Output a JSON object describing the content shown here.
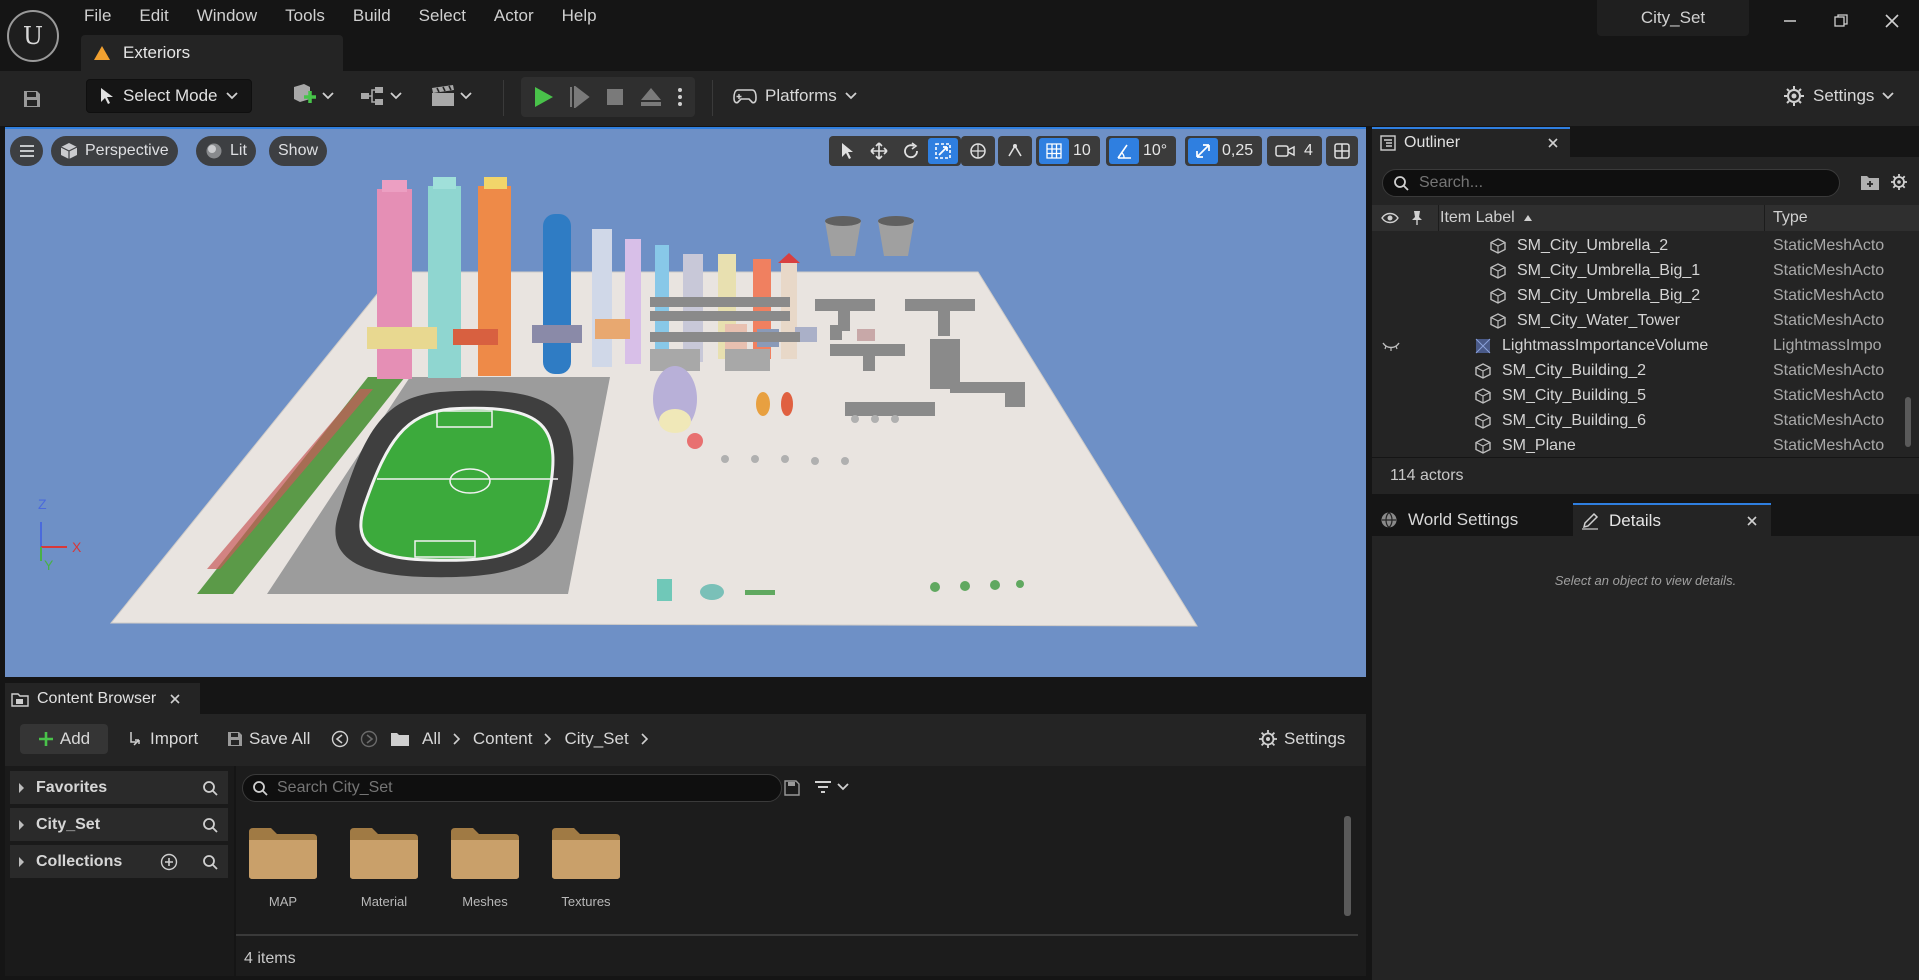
{
  "menu": [
    "File",
    "Edit",
    "Window",
    "Tools",
    "Build",
    "Select",
    "Actor",
    "Help"
  ],
  "level_tab": "Exteriors",
  "project_name": "City_Set",
  "toolbar": {
    "select_mode": "Select Mode",
    "platforms": "Platforms",
    "settings": "Settings"
  },
  "viewport": {
    "perspective": "Perspective",
    "lit": "Lit",
    "show": "Show",
    "grid_snap": "10",
    "rotation_snap": "10°",
    "scale_snap": "0,25",
    "camera_speed": "4",
    "axis": {
      "z": "Z",
      "x": "X",
      "y": "Y"
    },
    "colors": {
      "sky": "#6e90c6",
      "ground": "#e9e4e0",
      "field": "#3caa3c",
      "track": "#3f3f3f",
      "accent": "#2f7fe0"
    }
  },
  "outliner": {
    "title": "Outliner",
    "search_placeholder": "Search...",
    "col_label": "Item Label",
    "col_type": "Type",
    "rows": [
      {
        "label": "SM_City_Umbrella_2",
        "type": "StaticMeshActo",
        "indent": 2
      },
      {
        "label": "SM_City_Umbrella_Big_1",
        "type": "StaticMeshActo",
        "indent": 2
      },
      {
        "label": "SM_City_Umbrella_Big_2",
        "type": "StaticMeshActo",
        "indent": 2
      },
      {
        "label": "SM_City_Water_Tower",
        "type": "StaticMeshActo",
        "indent": 2
      },
      {
        "label": "LightmassImportanceVolume",
        "type": "LightmassImpo",
        "indent": 1
      },
      {
        "label": "SM_City_Building_2",
        "type": "StaticMeshActo",
        "indent": 1
      },
      {
        "label": "SM_City_Building_5",
        "type": "StaticMeshActo",
        "indent": 1
      },
      {
        "label": "SM_City_Building_6",
        "type": "StaticMeshActo",
        "indent": 1
      },
      {
        "label": "SM_Plane",
        "type": "StaticMeshActo",
        "indent": 1
      }
    ],
    "actor_count": "114 actors"
  },
  "details": {
    "world_settings_tab": "World Settings",
    "details_tab": "Details",
    "hint": "Select an object to view details."
  },
  "content_browser": {
    "tab": "Content Browser",
    "add": "Add",
    "import": "Import",
    "save_all": "Save All",
    "breadcrumbs": [
      "All",
      "Content",
      "City_Set"
    ],
    "settings": "Settings",
    "sidebar": [
      "Favorites",
      "City_Set",
      "Collections"
    ],
    "search_placeholder": "Search City_Set",
    "folders": [
      "MAP",
      "Material",
      "Meshes",
      "Textures"
    ],
    "items_count": "4 items"
  }
}
